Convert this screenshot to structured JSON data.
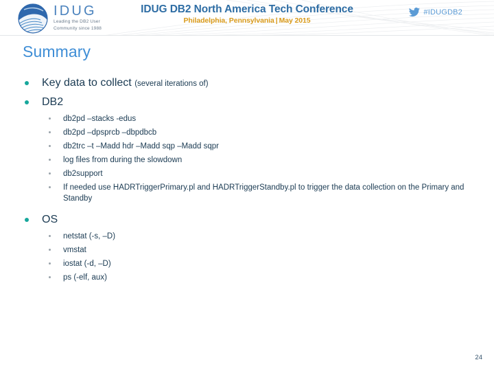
{
  "header": {
    "logo_word": "IDUG",
    "logo_tagline_line1": "Leading the DB2 User",
    "logo_tagline_line2": "Community since 1988",
    "conference_title": "IDUG DB2 North America Tech Conference",
    "conference_location": "Philadelphia, Pennsylvania",
    "conference_separator": "|",
    "conference_date": "May 2015",
    "twitter_hashtag": "#IDUGDB2",
    "twitter_icon": "twitter-bird-icon",
    "logo_icon": "idug-globe-icon"
  },
  "slide": {
    "title": "Summary",
    "page_number": "24"
  },
  "colors": {
    "title_blue": "#3f8ed6",
    "bullet_teal": "#17a79c",
    "sub_bullet_gray": "#9aa3ab",
    "body_navy": "#1a3a52",
    "conf_title_blue": "#2e6da4",
    "conf_sub_gold": "#d99a1a",
    "twitter_blue": "#5b9bd5"
  },
  "content": {
    "bullets": [
      {
        "text": "Key data to collect ",
        "note": "(several iterations of)",
        "sub": []
      },
      {
        "text": "DB2",
        "note": "",
        "sub": [
          "db2pd –stacks -edus",
          "db2pd –dpsprcb –dbpdbcb",
          "db2trc –t –Madd hdr –Madd sqp –Madd sqpr",
          "log files from during the slowdown",
          "db2support",
          "If needed use HADRTriggerPrimary.pl and HADRTriggerStandby.pl to trigger the data collection on the Primary and Standby"
        ]
      },
      {
        "text": "OS",
        "note": "",
        "sub": [
          "netstat (-s,  –D)",
          "vmstat",
          "iostat (-d,  –D)",
          "ps (-elf, aux)"
        ]
      }
    ]
  }
}
